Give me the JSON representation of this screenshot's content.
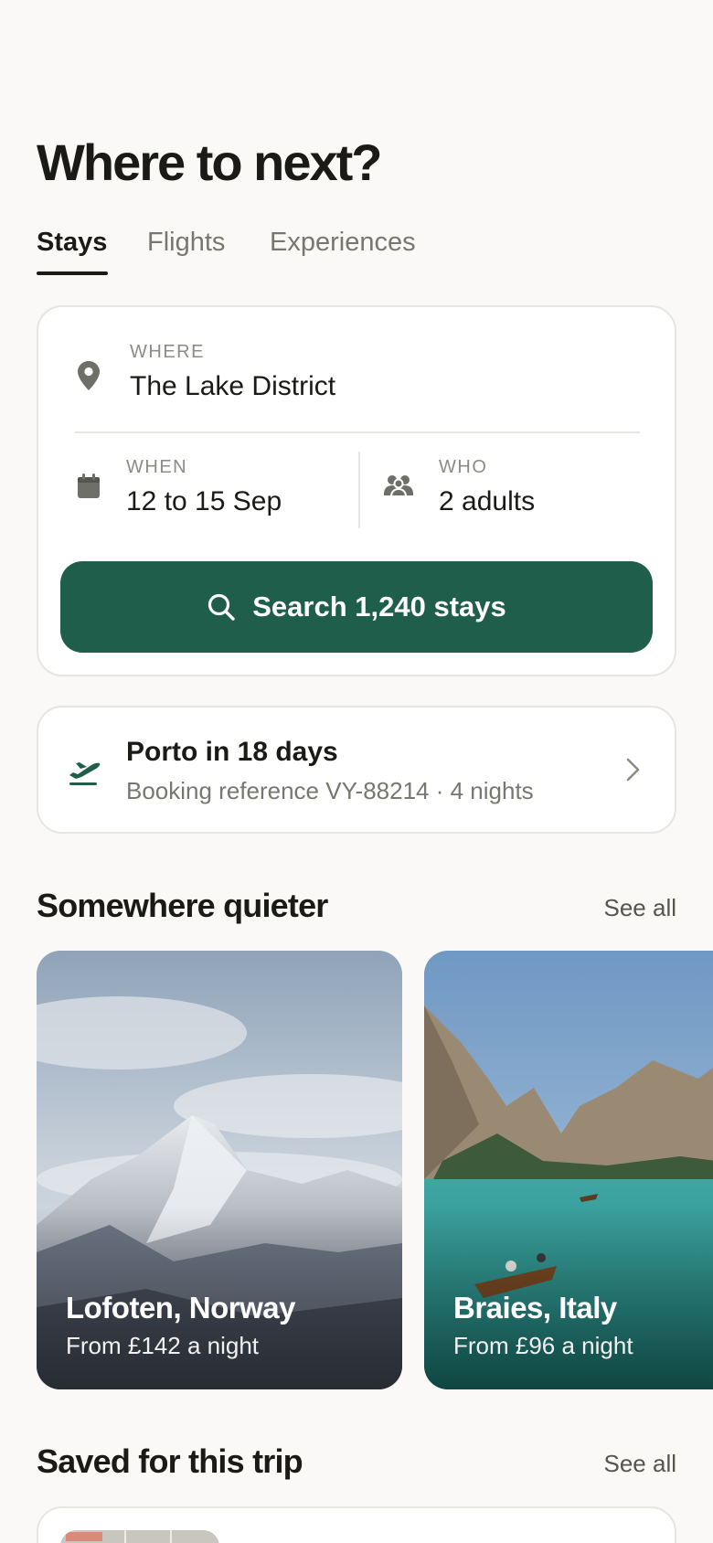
{
  "header": {
    "title": "Where to next?"
  },
  "tabs": [
    {
      "label": "Stays",
      "active": true
    },
    {
      "label": "Flights",
      "active": false
    },
    {
      "label": "Experiences",
      "active": false
    }
  ],
  "search": {
    "where_label": "WHERE",
    "where_value": "The Lake District",
    "when_label": "WHEN",
    "when_value": "12 to 15 Sep",
    "who_label": "WHO",
    "who_value": "2 adults",
    "button_label": "Search 1,240 stays",
    "icons": {
      "where": "map-pin-icon",
      "when": "calendar-icon",
      "who": "people-icon",
      "button": "search-icon"
    }
  },
  "upcoming_trip": {
    "title": "Porto in 18 days",
    "subtitle": "Booking reference VY-88214 · 4 nights",
    "icon": "plane-takeoff-icon"
  },
  "sections": {
    "quieter": {
      "title": "Somewhere quieter",
      "see_all": "See all"
    },
    "saved": {
      "title": "Saved for this trip",
      "see_all": "See all"
    }
  },
  "destinations": [
    {
      "name": "Lofoten, Norway",
      "price": "From £142 a night"
    },
    {
      "name": "Braies, Italy",
      "price": "From £96 a night"
    }
  ],
  "colors": {
    "background": "#faf9f7",
    "accent": "#1f5e4b",
    "text": "#1a1a17",
    "muted": "#77776f"
  }
}
